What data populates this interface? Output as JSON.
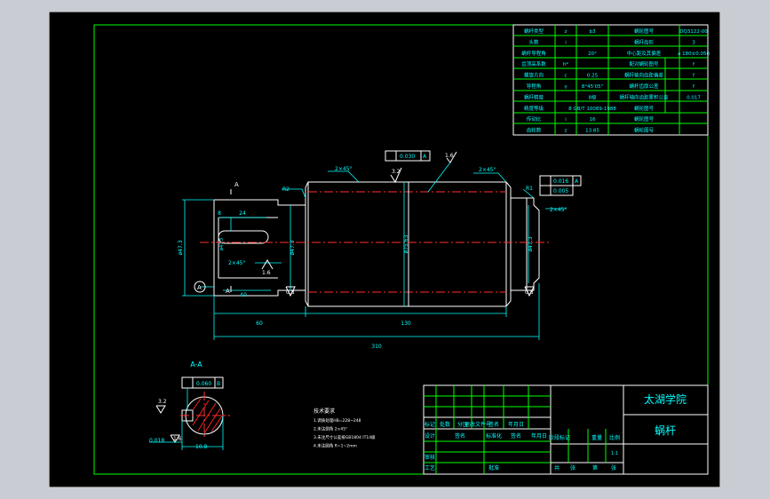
{
  "params": [
    [
      "蜗杆类型",
      "z",
      "b3",
      "蜗轮图号",
      "DQ3122-00"
    ],
    [
      "头数",
      "i",
      "",
      "蜗杆齿形",
      "3"
    ],
    [
      "蜗杆导程角",
      "",
      "20°",
      "中心距及其偏差",
      "a  180±0.050"
    ],
    [
      "齿顶高系数",
      "h*",
      "",
      "配对蜗轮图号",
      "f"
    ],
    [
      "螺旋方向",
      "c",
      "0.25",
      "蜗杆轴向齿距偏差",
      "f"
    ],
    [
      "导程角",
      "γ",
      "8°45'05\"",
      "蜗杆齿厚公差",
      "f"
    ],
    [
      "蜗杆精度",
      "",
      "8级",
      "蜗杆轴向齿距累积公差",
      "0.017"
    ],
    [
      "精度等级",
      "",
      "8 GB/T 10089-1988",
      "蜗轮图号",
      ""
    ],
    [
      "传动比",
      "i",
      "16",
      "蜗轮图号",
      ""
    ],
    [
      "齿轮数",
      "z",
      "13.85",
      "蜗轮图号",
      ""
    ]
  ],
  "dims": {
    "d60": "60",
    "d130": "130",
    "d310": "310",
    "d24": "24",
    "d8": "8",
    "d40": "40",
    "dia1": "ø47.3",
    "dia2": "ø47.3",
    "dia3": "ø75.63",
    "dia4": "ø47.3",
    "chamfer1": "2×45°",
    "chamfer2": "2×45°",
    "chamfer3": "2×45°",
    "chamfer4": "2×45°",
    "r1": "R2",
    "r2": "R1",
    "ra1": "3.2",
    "ra2": "1.6",
    "ra3": "0.8",
    "ra4": "0.8",
    "ra5": "1.6",
    "tol1": "0.030",
    "tol1_ref": "A",
    "tol2": "0.016",
    "tol2_ref": "A",
    "tol3": "0.005",
    "sec_label": "A",
    "sec_label2": "A",
    "circle_label": "A"
  },
  "section": {
    "title": "A-A",
    "tol": "0.060",
    "tol_ref": "B",
    "ra": "3.2",
    "ra2": "1.6",
    "dim1": "10.8",
    "dim2": "0.018"
  },
  "notes": {
    "title": "技术要求",
    "lines": [
      "1.调质处理HB=228~248",
      "2.未注倒角 2×45°",
      "3.未注尺寸公差按GB1804 IT14级",
      "4.未注圆角 R=1~2mm"
    ]
  },
  "titleblock": {
    "school": "太湖学院",
    "part": "蜗杆",
    "row1": [
      "标记",
      "处数",
      "分区",
      "更改文件号",
      "签名",
      "年月日"
    ],
    "row2": [
      "设计",
      "签名",
      "标准化",
      "签名",
      "年月日"
    ],
    "stage": [
      "阶段标记",
      "重量",
      "比例"
    ],
    "check": "审核",
    "process": "工艺",
    "approve": "批准",
    "sheet": [
      "共",
      "张",
      "第",
      "张"
    ],
    "scale": "1:1"
  }
}
